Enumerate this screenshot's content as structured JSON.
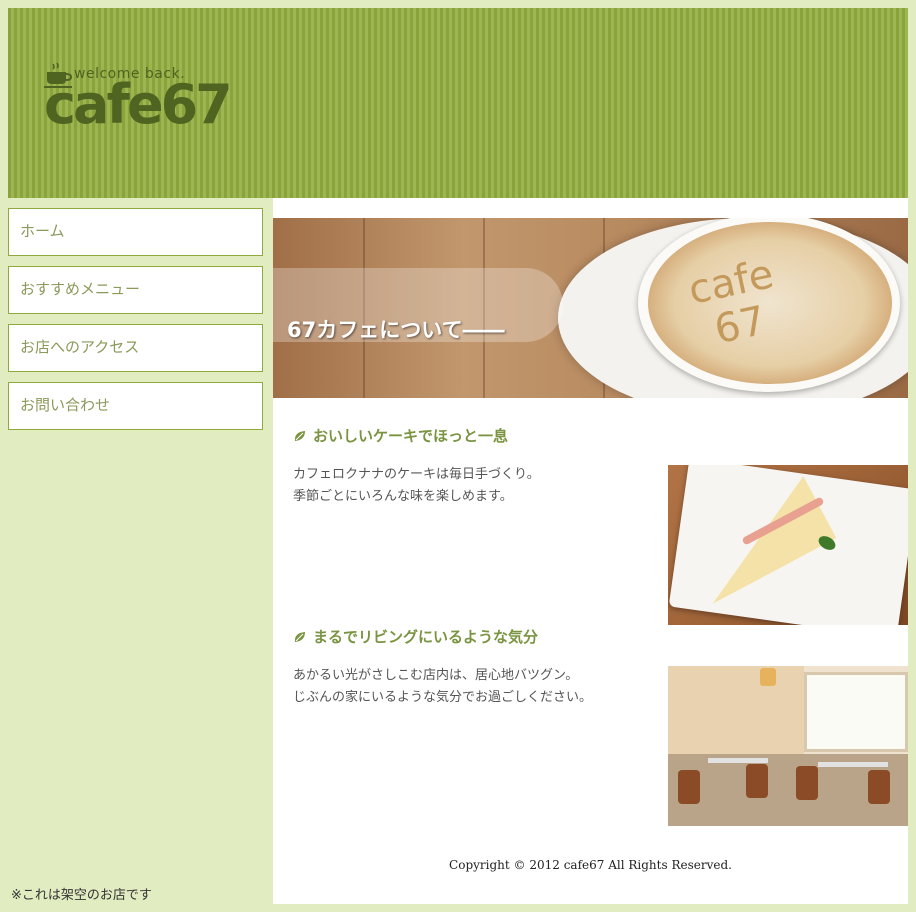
{
  "header": {
    "logo_tagline": "welcome back.",
    "logo_name": "cafe67"
  },
  "nav": {
    "items": [
      {
        "label": "ホーム"
      },
      {
        "label": "おすすめメニュー"
      },
      {
        "label": "お店へのアクセス"
      },
      {
        "label": "お問い合わせ"
      }
    ]
  },
  "sidebar_note": "※これは架空のお店です",
  "hero": {
    "title": "67カフェについて――",
    "latte_art_line1": "cafe",
    "latte_art_line2": "67"
  },
  "sections": [
    {
      "heading": "おいしいケーキでほっと一息",
      "line1": "カフェロクナナのケーキは毎日手づくり。",
      "line2": "季節ごとにいろんな味を楽しめます。",
      "icon": "leaf-icon"
    },
    {
      "heading": "まるでリビングにいるような気分",
      "line1": "あかるい光がさしこむ店内は、居心地バツグン。",
      "line2": "じぶんの家にいるような気分でお過ごしください。",
      "icon": "leaf-icon"
    }
  ],
  "footer": {
    "copyright": "Copyright © 2012 cafe67 All Rights Reserved."
  },
  "colors": {
    "header_green": "#8fa83f",
    "page_background": "#e2ecc1",
    "heading_green": "#7a9441",
    "logo_dark_green": "#4f6420"
  }
}
